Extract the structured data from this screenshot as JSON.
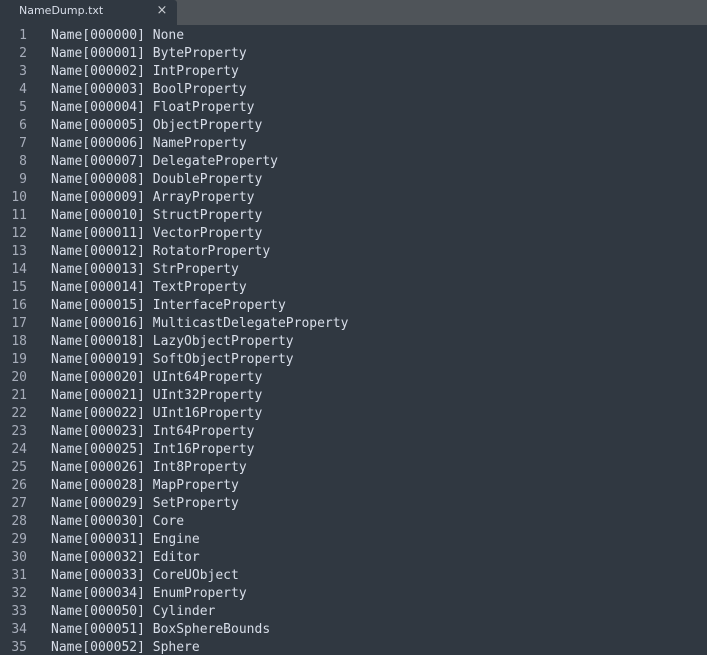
{
  "tab": {
    "title": "NameDump.txt",
    "close_glyph": "×"
  },
  "lines": [
    "Name[000000] None",
    "Name[000001] ByteProperty",
    "Name[000002] IntProperty",
    "Name[000003] BoolProperty",
    "Name[000004] FloatProperty",
    "Name[000005] ObjectProperty",
    "Name[000006] NameProperty",
    "Name[000007] DelegateProperty",
    "Name[000008] DoubleProperty",
    "Name[000009] ArrayProperty",
    "Name[000010] StructProperty",
    "Name[000011] VectorProperty",
    "Name[000012] RotatorProperty",
    "Name[000013] StrProperty",
    "Name[000014] TextProperty",
    "Name[000015] InterfaceProperty",
    "Name[000016] MulticastDelegateProperty",
    "Name[000018] LazyObjectProperty",
    "Name[000019] SoftObjectProperty",
    "Name[000020] UInt64Property",
    "Name[000021] UInt32Property",
    "Name[000022] UInt16Property",
    "Name[000023] Int64Property",
    "Name[000025] Int16Property",
    "Name[000026] Int8Property",
    "Name[000028] MapProperty",
    "Name[000029] SetProperty",
    "Name[000030] Core",
    "Name[000031] Engine",
    "Name[000032] Editor",
    "Name[000033] CoreUObject",
    "Name[000034] EnumProperty",
    "Name[000050] Cylinder",
    "Name[000051] BoxSphereBounds",
    "Name[000052] Sphere"
  ],
  "colors": {
    "editor_background": "#303841",
    "tab_bar_background": "#4f5459",
    "text": "#d8dee9",
    "line_number": "#a7adba"
  }
}
